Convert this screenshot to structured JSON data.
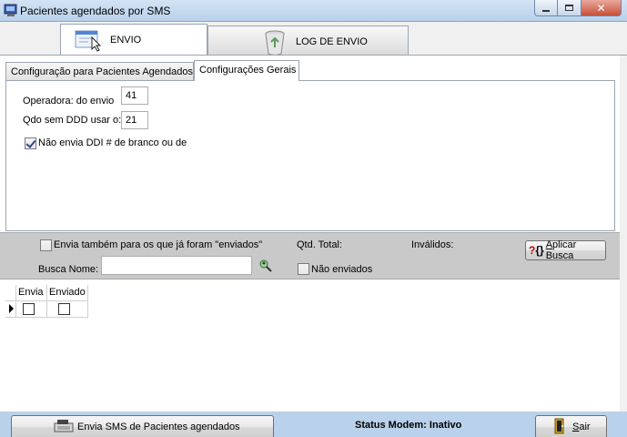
{
  "window": {
    "title": "Pacientes agendados por SMS",
    "controls": {
      "minimize": "minimize",
      "maximize": "maximize",
      "close": "close"
    }
  },
  "main_tabs": [
    {
      "label": "ENVIO",
      "icon": "message-window-icon",
      "active": true
    },
    {
      "label": "LOG DE ENVIO",
      "icon": "recycle-bin-icon",
      "active": false
    }
  ],
  "sub_tabs": [
    {
      "label": "Configuração para Pacientes Agendados",
      "active": false
    },
    {
      "label": "Configurações Gerais",
      "active": true
    }
  ],
  "settings": {
    "operadora_label": "Operadora: do envio",
    "operadora_value": "41",
    "ddd_label": "Qdo sem DDD usar o:",
    "ddd_value": "21",
    "ddi_label": "Não envia DDI #  de branco ou de",
    "ddi_checked": true
  },
  "filter": {
    "envia_tambem_label": "Envia também para os que já foram \"enviados\"",
    "envia_tambem_checked": false,
    "qtd_total_label": "Qtd. Total:",
    "invalidos_label": "Inválidos:",
    "aplicar_busca_pre": "",
    "aplicar_busca_hotkey": "A",
    "aplicar_busca_post": "plicar Busca",
    "busca_nome_label": "Busca Nome:",
    "busca_nome_value": "",
    "nao_enviados_label": "Não enviados",
    "nao_enviados_checked": false
  },
  "grid": {
    "columns": [
      "",
      "Envia",
      "Enviado"
    ]
  },
  "bottom": {
    "send_button_label": "Envia SMS de Pacientes agendados",
    "status_text": "Status Modem: Inativo",
    "exit_hotkey": "S",
    "exit_rest": "air"
  },
  "colors": {
    "titlebar": "#b9d1ea",
    "close_button": "#c7503a",
    "filter_band": "#c9c9c9"
  }
}
